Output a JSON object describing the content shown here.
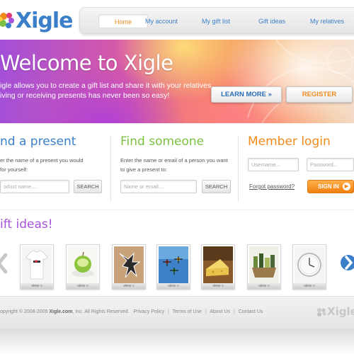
{
  "brand": {
    "logo_text": "Xigle"
  },
  "nav": {
    "items": [
      {
        "label": "Home",
        "active": true
      },
      {
        "label": "My account",
        "active": false
      },
      {
        "label": "My gift list",
        "active": false
      },
      {
        "label": "Gift ideas",
        "active": false
      },
      {
        "label": "My relatives",
        "active": false
      }
    ]
  },
  "hero": {
    "title": "Welcome to Xigle",
    "line1": "igle allows you to create a gift list and share it with your relatives.",
    "line2": "iving or receiving presents has never been so easy!",
    "learn_more_label": "LEARN MORE »",
    "register_label": "REGISTER"
  },
  "find_present": {
    "title": "nd a present",
    "desc_line1": "er the name of a present you would",
    "desc_line2": "for yourself:",
    "input_placeholder": "oduct name....",
    "search_label": "SEARCH",
    "title_color": "#3a7fc8"
  },
  "find_someone": {
    "title": "Find someone",
    "desc_line1": "Enter the name or email of a person you want",
    "desc_line2": "to give a present to:",
    "input_placeholder": "Name or email....",
    "search_label": "SEARCH",
    "title_color": "#7cc142"
  },
  "member_login": {
    "title": "Member login",
    "username_placeholder": "Username...",
    "password_placeholder": "Password...",
    "forgot_label": "Forgot password?",
    "signin_label": "SIGN IN",
    "title_color": "#f08a1c"
  },
  "gift_ideas": {
    "title": "ift ideas!",
    "items": [
      {
        "icon": "tshirt-photo",
        "view_label": "view »"
      },
      {
        "icon": "apple-photo",
        "view_label": "view »"
      },
      {
        "icon": "chalk-outline-photo",
        "view_label": "view »"
      },
      {
        "icon": "skydivers-photo",
        "view_label": "view »"
      },
      {
        "icon": "cheese-photo",
        "view_label": "view »"
      },
      {
        "icon": "gift-basket-photo",
        "view_label": "view »"
      },
      {
        "icon": "wall-clock-photo",
        "view_label": "view »"
      }
    ]
  },
  "footer": {
    "copyright_prefix": "opyright © 2008-2009",
    "company": "Xigle.com",
    "copyright_suffix": ", Inc. All Rights Reserved.",
    "links": [
      "Privacy Policy",
      "Terms of Use",
      "About Us",
      "Contact Us"
    ],
    "logo_text": "Xigle"
  }
}
